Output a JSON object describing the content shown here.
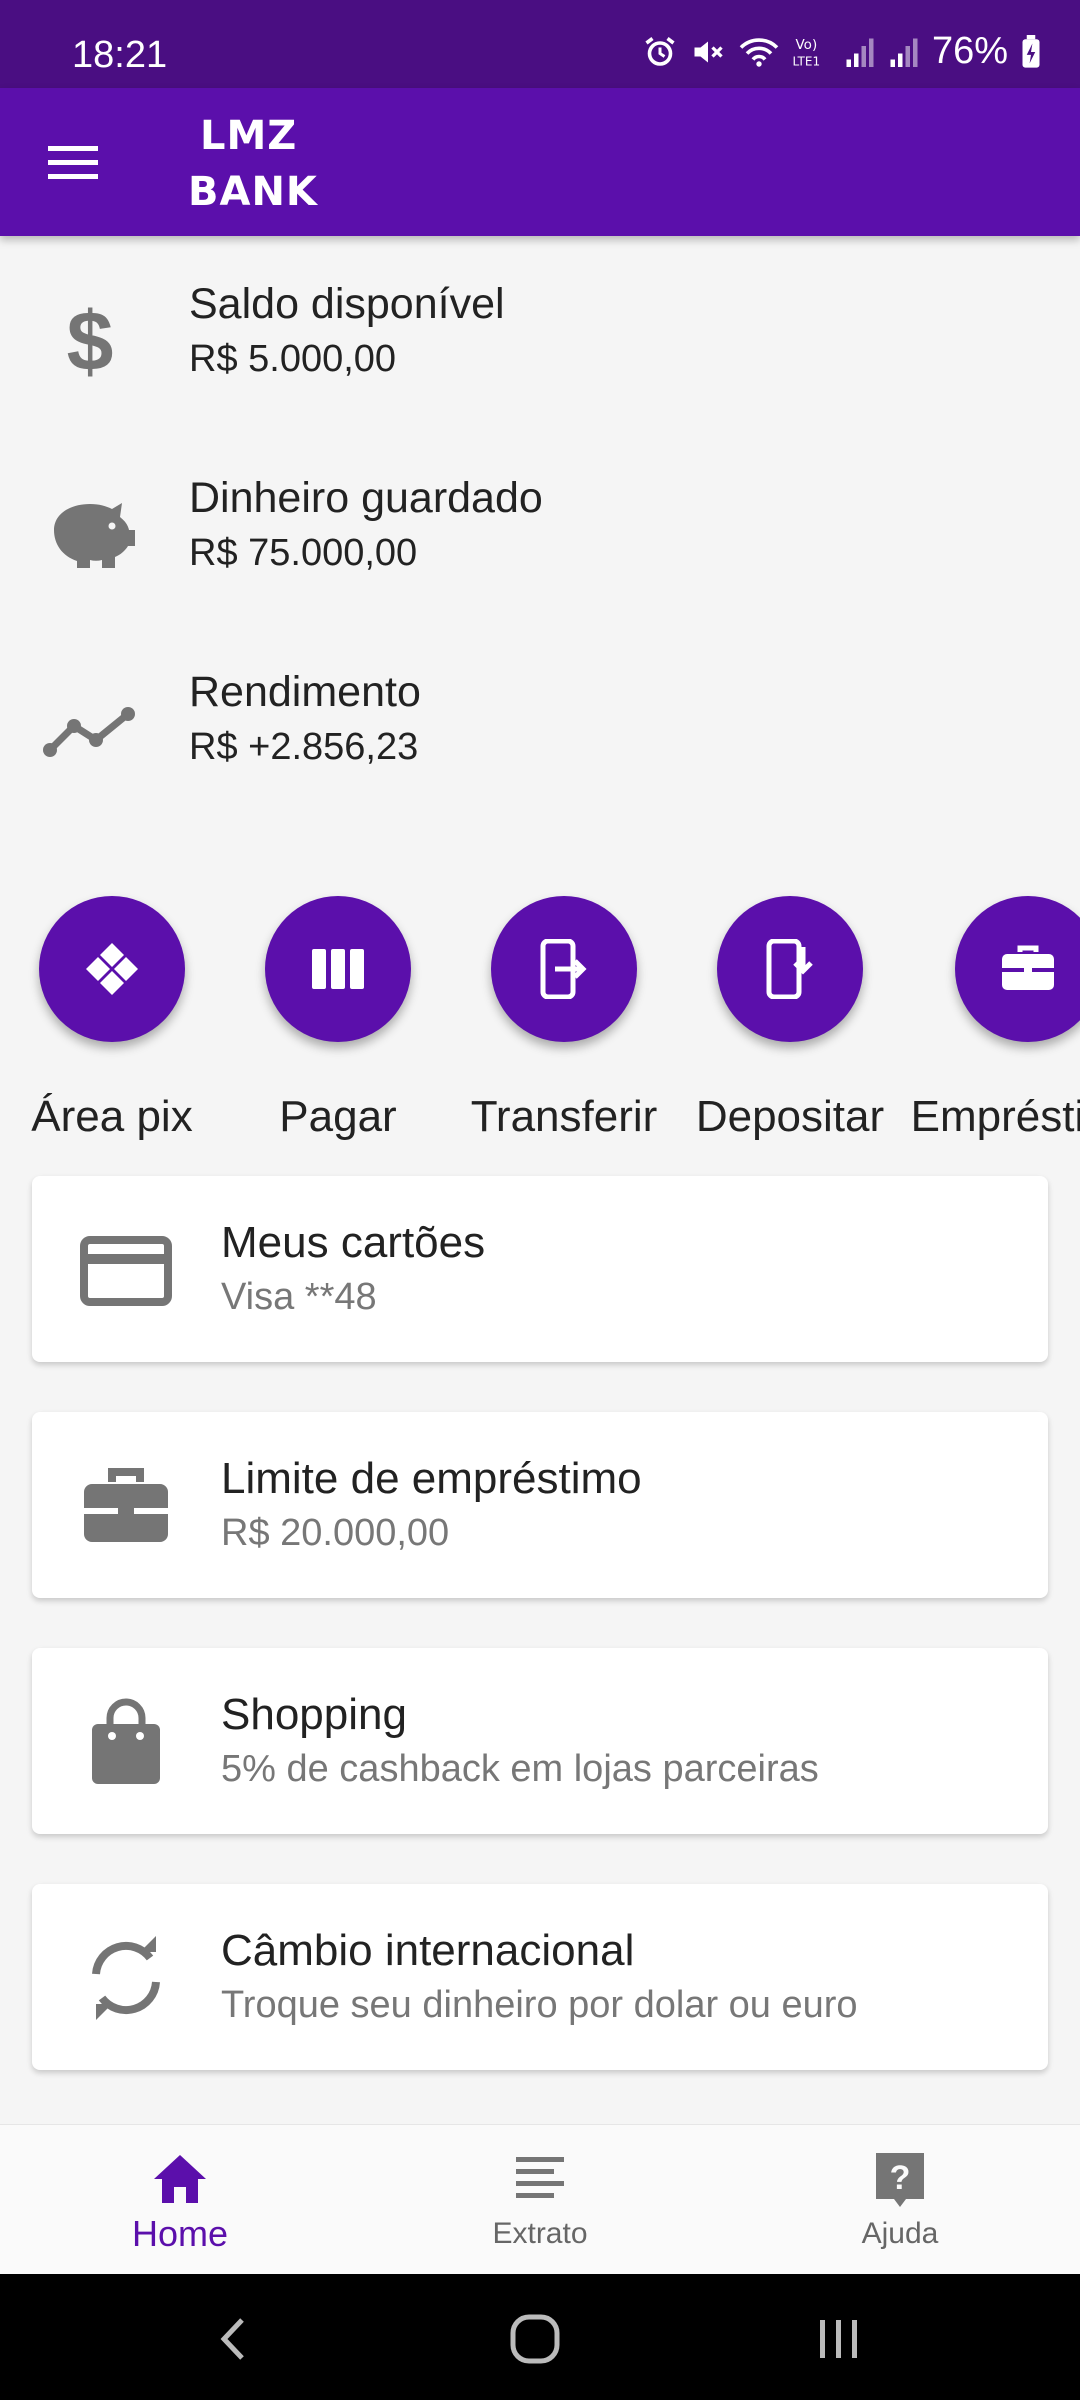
{
  "status_bar": {
    "time": "18:21",
    "battery": "76%",
    "icons": [
      "alarm-icon",
      "mute-icon",
      "wifi-icon",
      "volte-icon",
      "signal-icon",
      "signal-icon",
      "battery-charging-icon"
    ]
  },
  "app_bar": {
    "brand_line1": "LMZ",
    "brand_line2": "BANK",
    "menu_icon": "menu-icon"
  },
  "summary": [
    {
      "icon": "dollar-icon",
      "title": "Saldo disponível",
      "value": "R$ 5.000,00"
    },
    {
      "icon": "piggy-bank-icon",
      "title": "Dinheiro guardado",
      "value": "R$ 75.000,00"
    },
    {
      "icon": "trending-icon",
      "title": "Rendimento",
      "value": "R$ +2.856,23"
    }
  ],
  "actions": [
    {
      "icon": "pix-icon",
      "label": "Área pix"
    },
    {
      "icon": "barcode-icon",
      "label": "Pagar"
    },
    {
      "icon": "transfer-icon",
      "label": "Transferir"
    },
    {
      "icon": "deposit-icon",
      "label": "Depositar"
    },
    {
      "icon": "briefcase-icon",
      "label": "Empréstimo"
    }
  ],
  "cards": [
    {
      "icon": "credit-card-icon",
      "title": "Meus cartões",
      "subtitle": "Visa **48"
    },
    {
      "icon": "briefcase-icon",
      "title": "Limite de empréstimo",
      "subtitle": "R$ 20.000,00"
    },
    {
      "icon": "shopping-bag-icon",
      "title": "Shopping",
      "subtitle": "5% de cashback em lojas parceiras"
    },
    {
      "icon": "exchange-icon",
      "title": "Câmbio internacional",
      "subtitle": "Troque seu dinheiro por dolar ou euro"
    }
  ],
  "bottom_nav": [
    {
      "icon": "home-icon",
      "label": "Home",
      "active": true
    },
    {
      "icon": "statement-icon",
      "label": "Extrato",
      "active": false
    },
    {
      "icon": "help-icon",
      "label": "Ajuda",
      "active": false
    }
  ],
  "colors": {
    "primary": "#5b0fab",
    "status_bar": "#4a0e82",
    "icon_gray": "#757575",
    "background": "#f5f5f5"
  }
}
